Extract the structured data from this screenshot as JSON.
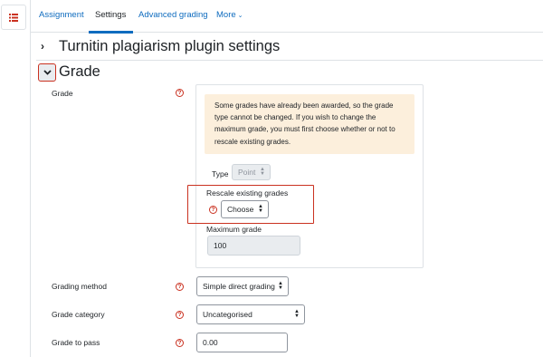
{
  "tabs": [
    {
      "label": "Assignment"
    },
    {
      "label": "Settings"
    },
    {
      "label": "Advanced grading"
    },
    {
      "label": "More"
    }
  ],
  "sections": {
    "turnitin_title": "Turnitin plagiarism plugin settings",
    "grade_title": "Grade"
  },
  "grade": {
    "label": "Grade",
    "warning": "Some grades have already been awarded, so the grade type cannot be changed. If you wish to change the maximum grade, you must first choose whether or not to rescale existing grades.",
    "type_label": "Type",
    "type_value": "Point",
    "rescale_label": "Rescale existing grades",
    "rescale_value": "Choose",
    "max_label": "Maximum grade",
    "max_value": "100"
  },
  "grading_method": {
    "label": "Grading method",
    "value": "Simple direct grading"
  },
  "grade_category": {
    "label": "Grade category",
    "value": "Uncategorised"
  },
  "grade_to_pass": {
    "label": "Grade to pass",
    "value": "0.00"
  },
  "colors": {
    "link": "#0f6cbf",
    "help_icon": "#ca3120",
    "warning_bg": "#fcefdc",
    "highlight": "#ca3120"
  },
  "icons": [
    "list-icon",
    "chevron-right-icon",
    "chevron-down-icon",
    "help-icon"
  ]
}
